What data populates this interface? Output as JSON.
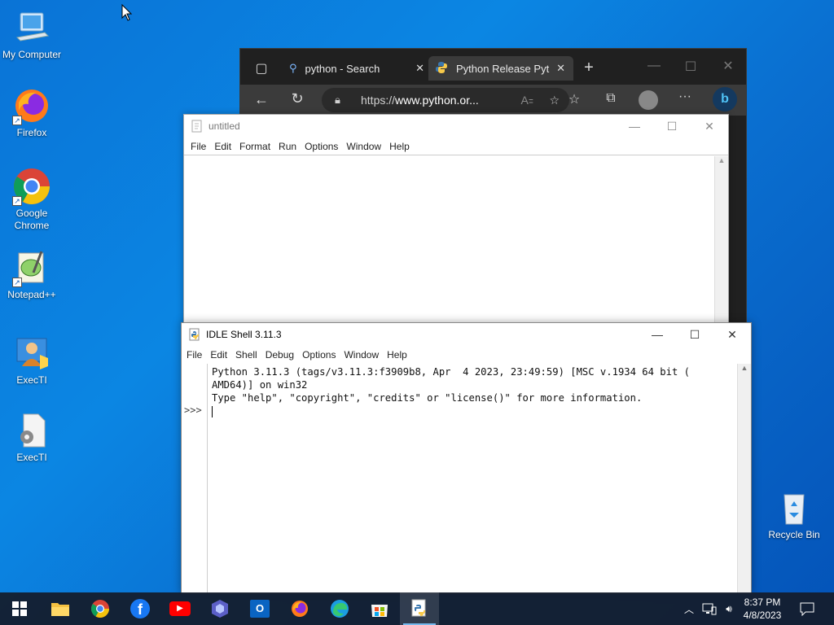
{
  "desktop": {
    "icons": [
      {
        "label": "My Computer"
      },
      {
        "label": "Firefox"
      },
      {
        "label": "Google Chrome"
      },
      {
        "label": "Notepad++"
      },
      {
        "label": "ExecTI"
      },
      {
        "label": "ExecTI"
      },
      {
        "label": "Recycle Bin"
      }
    ]
  },
  "edge": {
    "tabs": [
      {
        "label": "python - Search"
      },
      {
        "label": "Python Release Pytho"
      }
    ],
    "address_prefix": "https://",
    "address_host": "www.python.or..."
  },
  "editor": {
    "title": "untitled",
    "menu": [
      "File",
      "Edit",
      "Format",
      "Run",
      "Options",
      "Window",
      "Help"
    ]
  },
  "shell": {
    "title": "IDLE Shell 3.11.3",
    "menu": [
      "File",
      "Edit",
      "Shell",
      "Debug",
      "Options",
      "Window",
      "Help"
    ],
    "lines": [
      "Python 3.11.3 (tags/v3.11.3:f3909b8, Apr  4 2023, 23:49:59) [MSC v.1934 64 bit (",
      "AMD64)] on win32",
      "Type \"help\", \"copyright\", \"credits\" or \"license()\" for more information."
    ],
    "prompt": ">>>"
  },
  "taskbar": {
    "time": "8:37 PM",
    "date": "4/8/2023"
  },
  "colors": {
    "desktop_bg": "#0a73d6",
    "taskbar": "#141e2d",
    "edge_dark": "#202020"
  }
}
